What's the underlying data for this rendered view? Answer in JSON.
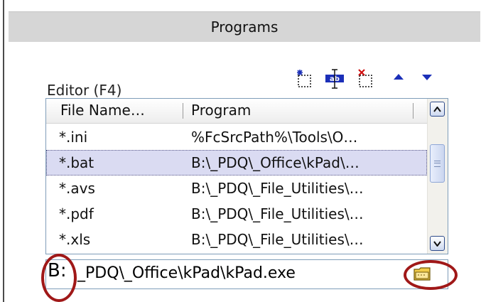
{
  "section": {
    "title": "Programs"
  },
  "toolbar": {
    "icons": [
      "new-entry-icon",
      "rename-icon",
      "delete-entry-icon",
      "move-up-icon",
      "move-down-icon"
    ],
    "accent": "#1b2fb8"
  },
  "editor": {
    "label": "Editor (F4)",
    "columns": [
      "File Name…",
      "Program"
    ],
    "rows": [
      {
        "file": "*.ini",
        "program": "%FcSrcPath%\\Tools\\O…"
      },
      {
        "file": "*.bat",
        "program": "B:\\_PDQ\\_Office\\kPad\\…"
      },
      {
        "file": "*.avs",
        "program": "B:\\_PDQ\\_File_Utilities\\…"
      },
      {
        "file": "*.pdf",
        "program": "B:\\_PDQ\\_File_Utilities\\…"
      },
      {
        "file": "*.xls",
        "program": "B:\\_PDQ\\_File_Utilities\\…"
      }
    ],
    "selected_index": 1
  },
  "path": {
    "drive": "B:",
    "rest": "_PDQ\\_Office\\kPad\\kPad.exe",
    "browse_icon": "folder-icon"
  },
  "colors": {
    "highlight_ring": "#a01818",
    "selection": "#dadbf2",
    "header_bg": "#d6d6d6"
  }
}
